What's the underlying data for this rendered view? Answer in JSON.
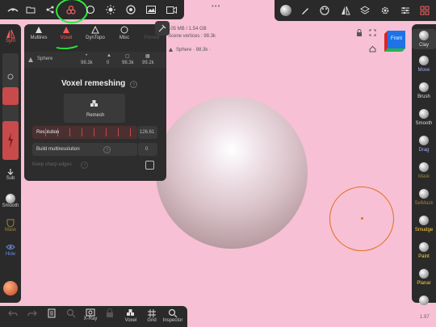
{
  "top_left_toolbar": {
    "items": [
      {
        "name": "project-icon"
      },
      {
        "name": "files-icon"
      },
      {
        "name": "scene-icon"
      },
      {
        "name": "tools-icon"
      },
      {
        "name": "settings-icon"
      },
      {
        "name": "sun-icon"
      },
      {
        "name": "material-icon"
      },
      {
        "name": "image-icon"
      },
      {
        "name": "video-icon"
      }
    ]
  },
  "top_right_toolbar": {
    "items": [
      {
        "name": "matcap-icon"
      },
      {
        "name": "pen-icon"
      },
      {
        "name": "palette-icon"
      },
      {
        "name": "symmetry-icon"
      },
      {
        "name": "layers-icon"
      },
      {
        "name": "gear-icon"
      },
      {
        "name": "sliders-icon"
      },
      {
        "name": "grid-icon"
      }
    ]
  },
  "left_column": {
    "sym_label": "Sym",
    "sub_label": "Sub",
    "smooth_label": "Smooth",
    "mask_label": "Mask",
    "hide_label": "Hide"
  },
  "right_column": {
    "tools": [
      "Clay",
      "Move",
      "Brush",
      "Smooth",
      "Drag",
      "Mask",
      "SelMask",
      "Smudge",
      "Paint",
      "Planar"
    ]
  },
  "bottom_bar": {
    "items": [
      "",
      "",
      "",
      "",
      "X-Ray",
      "",
      "Voxel",
      "Grid",
      "Inspector"
    ]
  },
  "panel": {
    "tabs": [
      "Multires",
      "Voxel",
      "DynTopo",
      "Misc",
      "Pinned"
    ],
    "object_name": "Sphere",
    "stats": [
      "98.3k",
      "0",
      "98.3k",
      "99.2k"
    ],
    "title": "Voxel remeshing",
    "remesh_label": "Remesh",
    "resolution_label": "Resolution",
    "resolution_value": "126.61",
    "multires_label": "Build multiresolution",
    "multires_value": "0",
    "sharp_label": "Keep sharp edges"
  },
  "info": {
    "memory": "105 MB / 1.54 GB",
    "scene_vertices": "Scene vertices : 98.3k",
    "object": "Sphere · 98.3k · ",
    "version": "1.97"
  },
  "view_cube_label": "Front",
  "colors": {
    "accent": "#e0701a",
    "highlight": "#2ee83f",
    "active_tab": "#ff5a5a"
  }
}
